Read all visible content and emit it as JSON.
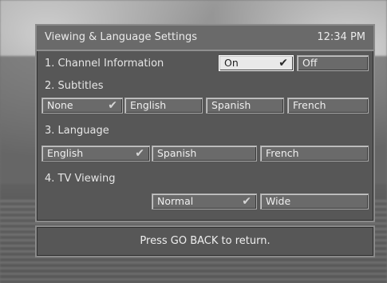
{
  "header": {
    "title": "Viewing & Language Settings",
    "time": "12:34 PM"
  },
  "sections": {
    "channel_information": {
      "label": "1.  Channel Information",
      "options": [
        "On",
        "Off"
      ],
      "selected": "On"
    },
    "subtitles": {
      "label": "2.  Subtitles",
      "options": [
        "None",
        "English",
        "Spanish",
        "French"
      ],
      "selected": "None"
    },
    "language": {
      "label": "3.  Language",
      "options": [
        "English",
        "Spanish",
        "French"
      ],
      "selected": "English"
    },
    "tv_viewing": {
      "label": "4.  TV Viewing",
      "options": [
        "Normal",
        "Wide"
      ],
      "selected": "Normal"
    }
  },
  "footer": {
    "hint": "Press GO BACK to return."
  },
  "icons": {
    "selected_marker": "check-icon"
  }
}
